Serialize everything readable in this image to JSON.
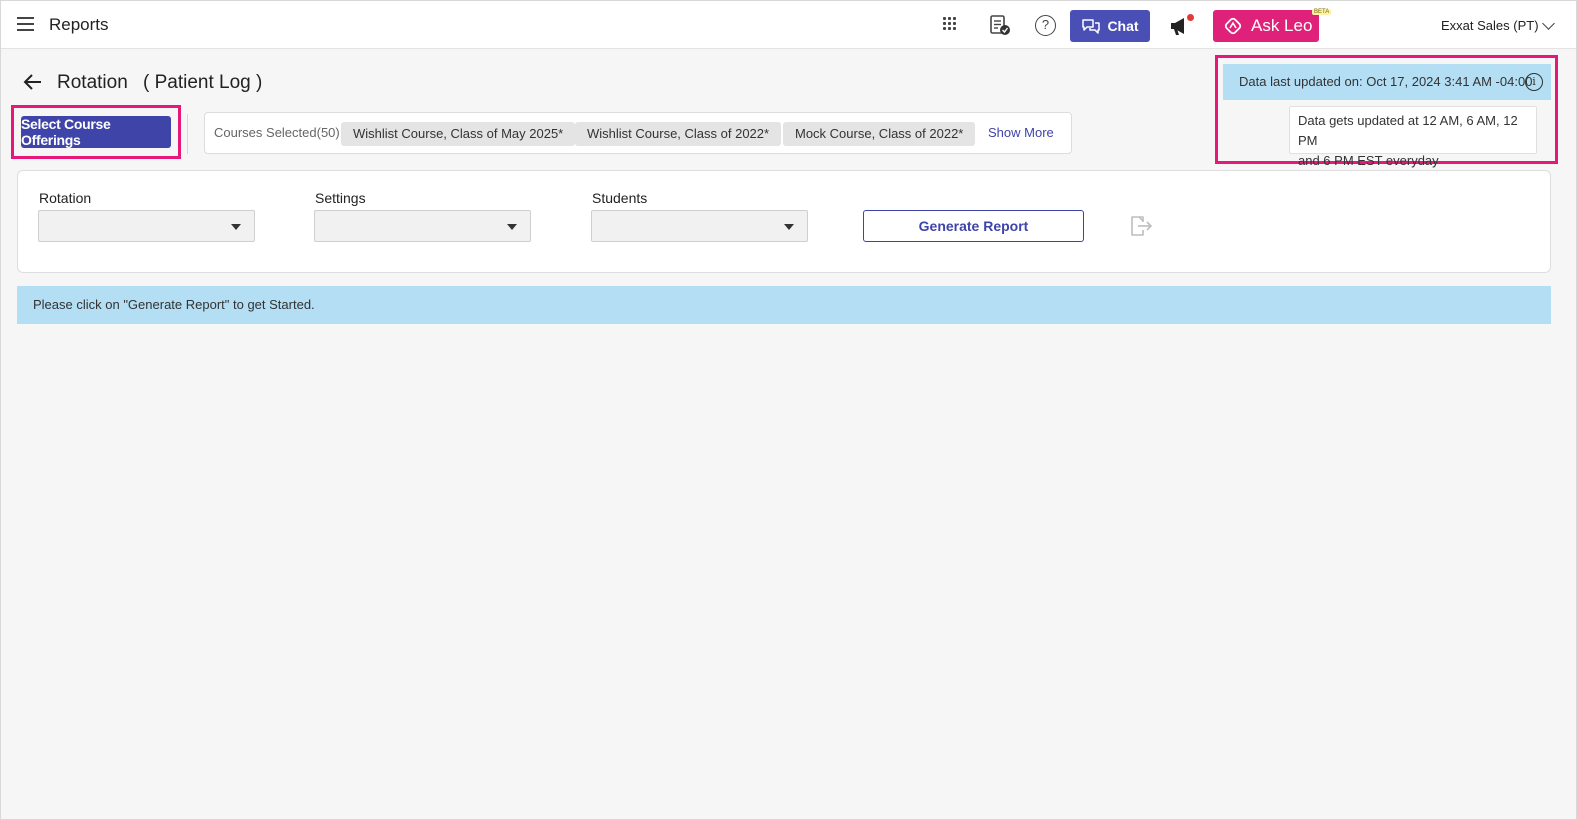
{
  "header": {
    "app_title": "Reports",
    "chat_label": "Chat",
    "ask_leo_label": "Ask Leo",
    "beta_badge": "BETA",
    "account_name": "Exxat Sales (PT)",
    "help_glyph": "?"
  },
  "page": {
    "title": "Rotation",
    "subtitle": "( Patient Log )"
  },
  "courses": {
    "select_button_label": "Select Course Offerings",
    "selected_label": "Courses Selected(50):",
    "chips": [
      "Wishlist Course, Class of May 2025*",
      "Wishlist Course, Class of 2022*",
      "Mock Course, Class of 2022*"
    ],
    "show_more_label": "Show More"
  },
  "data_status": {
    "last_updated": "Data last updated on: Oct 17, 2024 3:41 AM -04:00",
    "info_glyph": "i",
    "schedule_line1": "Data gets updated at 12 AM, 6 AM, 12 PM",
    "schedule_line2": "and 6 PM EST everyday"
  },
  "filters": {
    "rotation_label": "Rotation",
    "settings_label": "Settings",
    "students_label": "Students",
    "generate_label": "Generate Report"
  },
  "banner": {
    "message": "Please click on \"Generate Report\" to get Started."
  },
  "colors": {
    "primary": "#3f44a8",
    "chat": "#4a4fb5",
    "leo": "#e0217a",
    "highlight": "#e6197a",
    "info_bg": "#b3def4"
  },
  "icons": [
    "menu-icon",
    "apps-grid-icon",
    "document-check-icon",
    "help-icon",
    "chat-icon",
    "megaphone-icon",
    "leo-logo-icon",
    "chevron-down-icon",
    "back-arrow-icon",
    "info-icon",
    "dropdown-caret-icon",
    "export-icon"
  ]
}
